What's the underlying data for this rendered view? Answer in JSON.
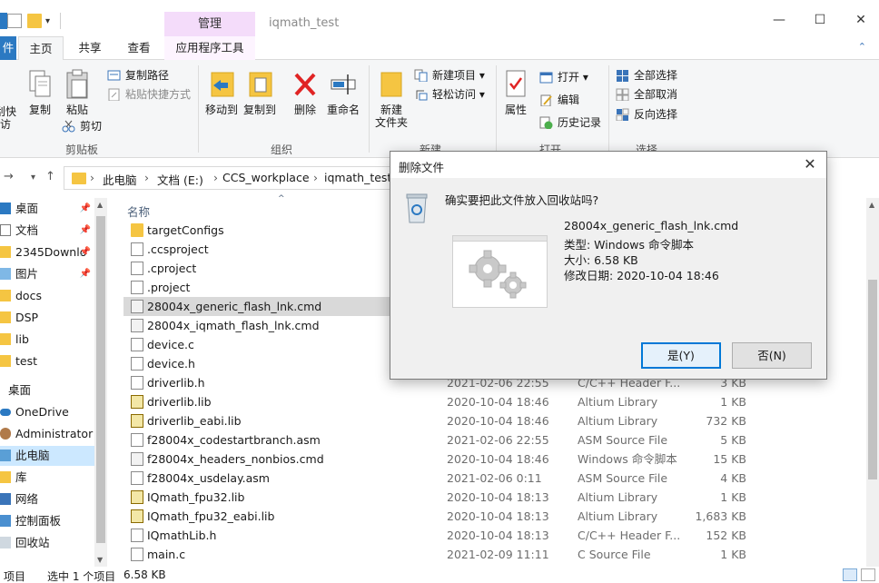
{
  "window": {
    "title": "iqmath_test",
    "context_tab_top": "管理",
    "minimize": "—",
    "maximize": "☐",
    "close": "✕"
  },
  "ribbon_tabs": [
    {
      "label": "主页"
    },
    {
      "label": "共享"
    },
    {
      "label": "查看"
    },
    {
      "label": "应用程序工具"
    }
  ],
  "ribbon": {
    "pin_partial": "刮快",
    "pin_partial2": "访",
    "copy": "复制",
    "paste": "粘贴",
    "copy_path": "复制路径",
    "paste_shortcut": "粘贴快捷方式",
    "cut": "剪切",
    "group_clipboard": "剪贴板",
    "move_to": "移动到",
    "copy_to": "复制到",
    "delete": "删除",
    "rename": "重命名",
    "group_organize": "组织",
    "new_folder_1": "新建",
    "new_folder_2": "文件夹",
    "new_item": "新建项目",
    "easy_access": "轻松访问",
    "group_new": "新建",
    "properties": "属性",
    "open": "打开",
    "edit": "编辑",
    "history": "历史记录",
    "group_open": "打开",
    "select_all": "全部选择",
    "select_none": "全部取消",
    "invert_selection": "反向选择",
    "group_select": "选择"
  },
  "address": {
    "crumbs": [
      "此电脑",
      "文档 (E:)",
      "CCS_workplace",
      "iqmath_test"
    ]
  },
  "nav_pane": [
    {
      "label": "桌面",
      "pinned": true
    },
    {
      "label": "文档",
      "pinned": true
    },
    {
      "label": "2345Downlo",
      "pinned": true
    },
    {
      "label": "图片",
      "pinned": true
    },
    {
      "label": "docs"
    },
    {
      "label": "DSP"
    },
    {
      "label": "lib"
    },
    {
      "label": "test"
    },
    {
      "label": "桌面"
    },
    {
      "label": "OneDrive"
    },
    {
      "label": "Administrator"
    },
    {
      "label": "此电脑",
      "selected": true
    },
    {
      "label": "库"
    },
    {
      "label": "网络"
    },
    {
      "label": "控制面板"
    },
    {
      "label": "回收站"
    }
  ],
  "list": {
    "col_name": "名称",
    "rows": [
      {
        "name": "targetConfigs",
        "date": "",
        "type": "",
        "size": "",
        "icon": "folder"
      },
      {
        "name": ".ccsproject",
        "date": "",
        "type": "",
        "size": "",
        "icon": "file"
      },
      {
        "name": ".cproject",
        "date": "",
        "type": "",
        "size": "",
        "icon": "file"
      },
      {
        "name": ".project",
        "date": "",
        "type": "",
        "size": "",
        "icon": "file"
      },
      {
        "name": "28004x_generic_flash_lnk.cmd",
        "date": "",
        "type": "",
        "size": "",
        "icon": "cmd",
        "selected": true
      },
      {
        "name": "28004x_iqmath_flash_lnk.cmd",
        "date": "",
        "type": "",
        "size": "",
        "icon": "cmd"
      },
      {
        "name": "device.c",
        "date": "",
        "type": "",
        "size": "",
        "icon": "file"
      },
      {
        "name": "device.h",
        "date": "",
        "type": "",
        "size": "",
        "icon": "file"
      },
      {
        "name": "driverlib.h",
        "date": "2021-02-06 22:55",
        "type": "C/C++ Header F...",
        "size": "3 KB",
        "icon": "file"
      },
      {
        "name": "driverlib.lib",
        "date": "2020-10-04 18:46",
        "type": "Altium Library",
        "size": "1 KB",
        "icon": "lib"
      },
      {
        "name": "driverlib_eabi.lib",
        "date": "2020-10-04 18:46",
        "type": "Altium Library",
        "size": "732 KB",
        "icon": "lib"
      },
      {
        "name": "f28004x_codestartbranch.asm",
        "date": "2021-02-06 22:55",
        "type": "ASM Source File",
        "size": "5 KB",
        "icon": "asm"
      },
      {
        "name": "f28004x_headers_nonbios.cmd",
        "date": "2020-10-04 18:46",
        "type": "Windows 命令脚本",
        "size": "15 KB",
        "icon": "cmd"
      },
      {
        "name": "f28004x_usdelay.asm",
        "date": "2021-02-06 0:11",
        "type": "ASM Source File",
        "size": "4 KB",
        "icon": "asm"
      },
      {
        "name": "IQmath_fpu32.lib",
        "date": "2020-10-04 18:13",
        "type": "Altium Library",
        "size": "1 KB",
        "icon": "lib"
      },
      {
        "name": "IQmath_fpu32_eabi.lib",
        "date": "2020-10-04 18:13",
        "type": "Altium Library",
        "size": "1,683 KB",
        "icon": "lib"
      },
      {
        "name": "IQmathLib.h",
        "date": "2020-10-04 18:13",
        "type": "C/C++ Header F...",
        "size": "152 KB",
        "icon": "file"
      },
      {
        "name": "main.c",
        "date": "2021-02-09 11:11",
        "type": "C Source File",
        "size": "1 KB",
        "icon": "file"
      }
    ]
  },
  "status": {
    "count": "项目",
    "selected": "选中 1 个项目",
    "size": "6.58 KB"
  },
  "dialog": {
    "title": "删除文件",
    "question": "确实要把此文件放入回收站吗?",
    "file_name": "28004x_generic_flash_lnk.cmd",
    "type_line": "类型: Windows 命令脚本",
    "size_line": "大小: 6.58 KB",
    "date_line": "修改日期: 2020-10-04 18:46",
    "yes": "是(Y)",
    "no": "否(N)"
  }
}
